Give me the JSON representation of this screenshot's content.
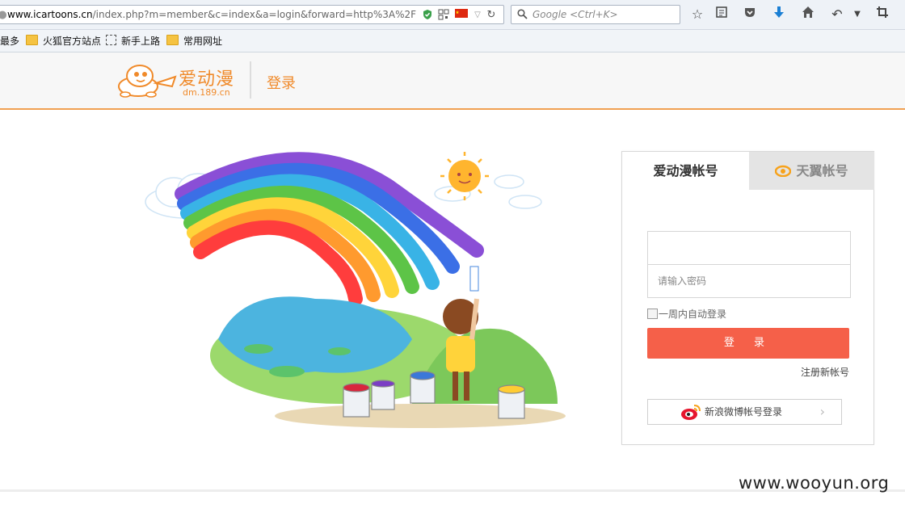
{
  "browser": {
    "url_host": "www.icartoons.cn",
    "url_rest": "/index.php?m=member&c=index&a=login&forward=http%3A%2F%2",
    "search_placeholder": "Google <Ctrl+K>",
    "icons": [
      "bookmark-star-icon",
      "reading-list-icon",
      "pocket-icon",
      "download-icon",
      "home-icon",
      "undo-icon",
      "dropdown-icon",
      "crop-icon"
    ]
  },
  "bookmarks": [
    {
      "label": "最多",
      "icon": "none"
    },
    {
      "label": "火狐官方站点",
      "icon": "folder-icon"
    },
    {
      "label": "新手上路",
      "icon": "dashed-box-icon"
    },
    {
      "label": "常用网址",
      "icon": "folder-icon"
    }
  ],
  "header": {
    "logo_text": "爱动漫",
    "logo_sub": "dm.189.cn",
    "title": "登录"
  },
  "login": {
    "tabs": [
      {
        "label": "爱动漫帐号",
        "active": true
      },
      {
        "label": "天翼帐号",
        "active": false
      }
    ],
    "username_value": "",
    "password_placeholder": "请输入密码",
    "remember_label": "一周内自动登录",
    "remember_checked": false,
    "submit_label": "登 录",
    "register_label": "注册新帐号",
    "weibo_label": "新浪微博帐号登录"
  },
  "watermark": "www.wooyun.org",
  "colors": {
    "accent_orange": "#f08a2a",
    "button_red": "#f56049"
  }
}
